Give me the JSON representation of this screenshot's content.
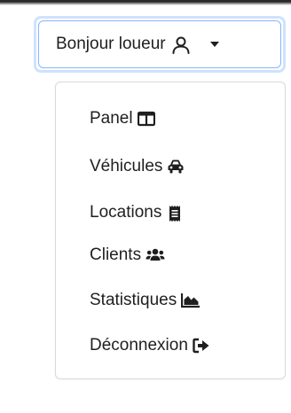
{
  "toggle": {
    "label": "Bonjour loueur",
    "icon": "user-icon"
  },
  "menu": {
    "items": [
      {
        "label": "Panel",
        "icon": "columns-icon"
      },
      {
        "label": "Véhicules",
        "icon": "car-icon"
      },
      {
        "label": "Locations",
        "icon": "receipt-icon"
      },
      {
        "label": "Clients",
        "icon": "users-icon"
      },
      {
        "label": "Statistiques",
        "icon": "area-chart-icon"
      },
      {
        "label": "Déconnexion",
        "icon": "sign-out-icon"
      }
    ]
  },
  "colors": {
    "focus_ring": "#cfe2ff",
    "focus_border": "#86b7fe",
    "text": "#1f1f1f",
    "menu_border": "#d9d9d9"
  }
}
